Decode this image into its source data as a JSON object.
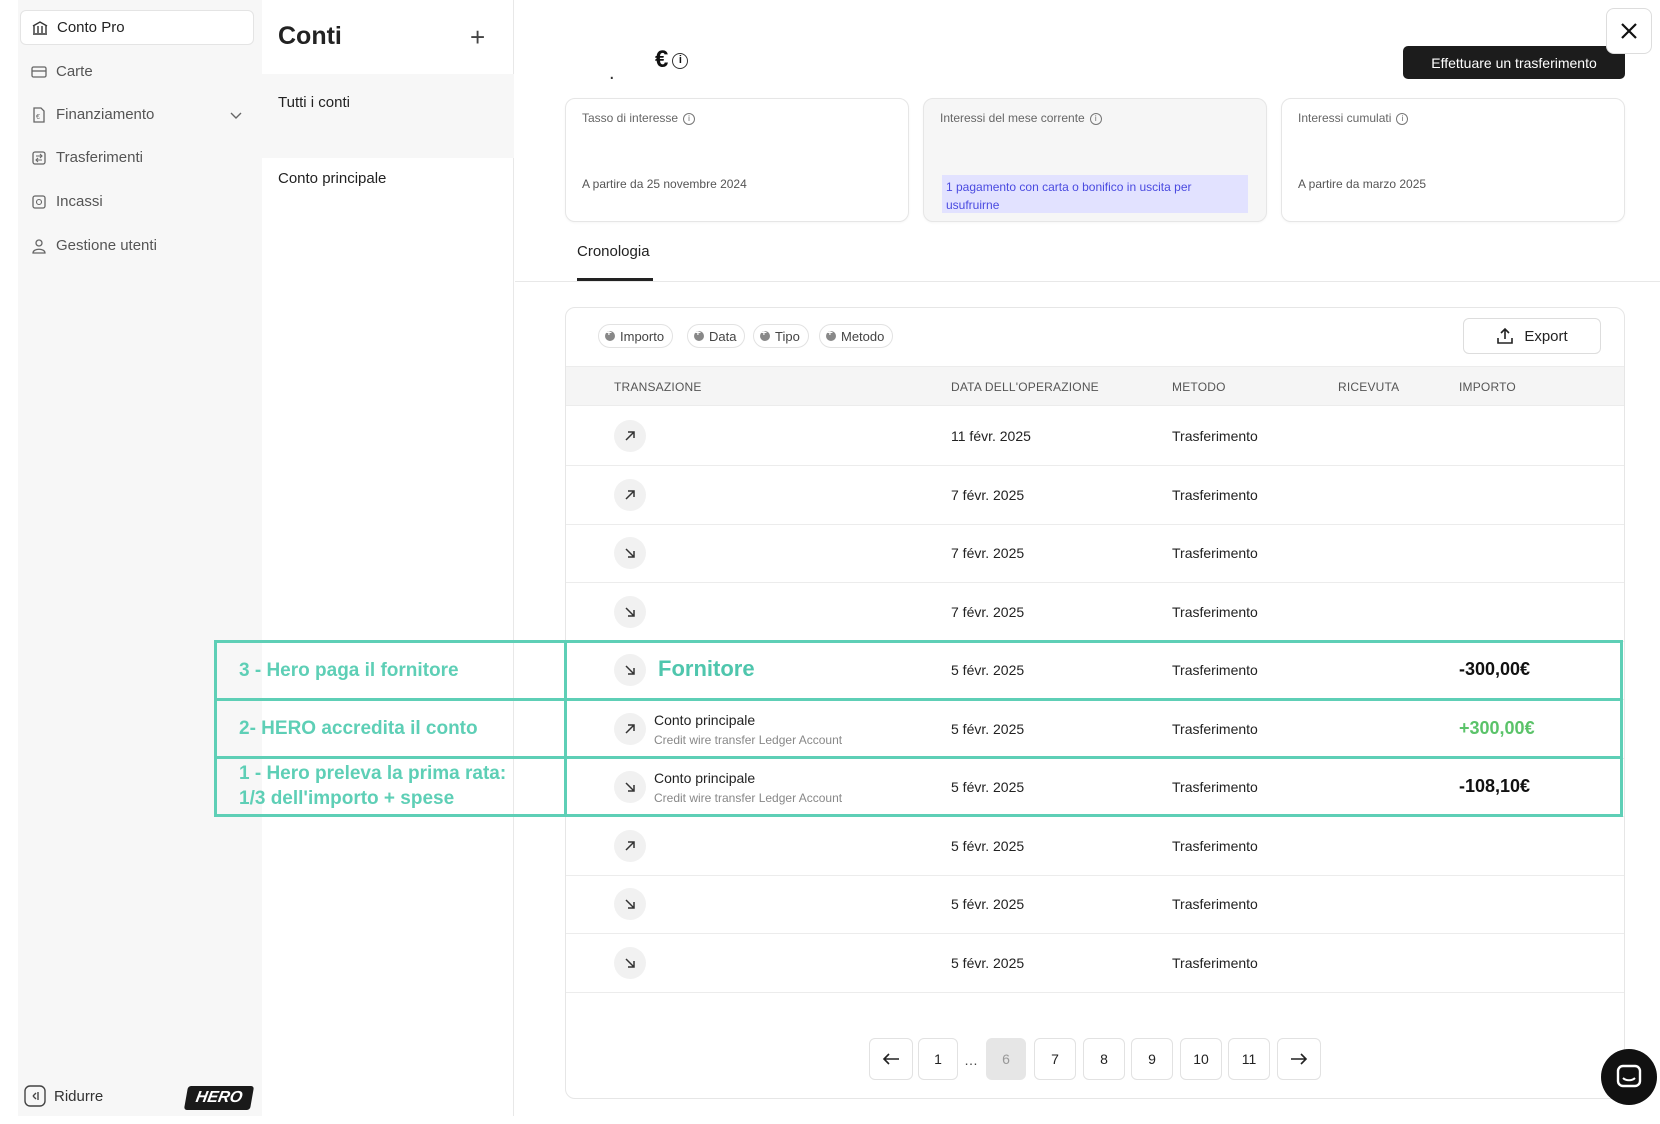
{
  "sidebar": {
    "items": [
      {
        "label": "Conto Pro",
        "icon": "bank-icon"
      },
      {
        "label": "Carte",
        "icon": "card-icon"
      },
      {
        "label": "Finanziamento",
        "icon": "document-euro-icon"
      },
      {
        "label": "Trasferimenti",
        "icon": "transfer-icon"
      },
      {
        "label": "Incassi",
        "icon": "collect-icon"
      },
      {
        "label": "Gestione utenti",
        "icon": "user-icon"
      }
    ],
    "collapse_label": "Ridurre",
    "logo_text": "HERO"
  },
  "accounts": {
    "title": "Conti",
    "add_label": "+",
    "all_label": "Tutti i conti",
    "main_label": "Conto principale"
  },
  "header": {
    "balance_value": ".",
    "currency": "€",
    "transfer_button": "Effettuare un trasferimento"
  },
  "cards": [
    {
      "label": "Tasso di interesse",
      "sub": "A partire da 25 novembre 2024"
    },
    {
      "label": "Interessi del mese corrente",
      "highlight": "1 pagamento con carta o bonifico in uscita per usufruirne"
    },
    {
      "label": "Interessi cumulati",
      "sub": "A partire da marzo 2025"
    }
  ],
  "tabs": {
    "history": "Cronologia"
  },
  "filters": [
    "Importo",
    "Data",
    "Tipo",
    "Metodo"
  ],
  "export_label": "Export",
  "table": {
    "headers": [
      "TRANSAZIONE",
      "DATA DELL'OPERAZIONE",
      "METODO",
      "RICEVUTA",
      "IMPORTO"
    ],
    "rows": [
      {
        "direction": "out",
        "name": "",
        "sub": "",
        "date": "11 févr. 2025",
        "method": "Trasferimento",
        "amount": ""
      },
      {
        "direction": "out",
        "name": "",
        "sub": "",
        "date": "7 févr. 2025",
        "method": "Trasferimento",
        "amount": ""
      },
      {
        "direction": "in",
        "name": "",
        "sub": "",
        "date": "7 févr. 2025",
        "method": "Trasferimento",
        "amount": ""
      },
      {
        "direction": "in",
        "name": "",
        "sub": "",
        "date": "7 févr. 2025",
        "method": "Trasferimento",
        "amount": ""
      },
      {
        "direction": "in",
        "name": "Fornitore",
        "sub": "",
        "date": "5 févr. 2025",
        "method": "Trasferimento",
        "amount": "-300,00€"
      },
      {
        "direction": "out",
        "name": "Conto principale",
        "sub": "Credit wire transfer Ledger Account",
        "date": "5 févr. 2025",
        "method": "Trasferimento",
        "amount": "+300,00€"
      },
      {
        "direction": "in",
        "name": "Conto principale",
        "sub": "Credit wire transfer Ledger Account",
        "date": "5 févr. 2025",
        "method": "Trasferimento",
        "amount": "-108,10€"
      },
      {
        "direction": "out",
        "name": "",
        "sub": "",
        "date": "5 févr. 2025",
        "method": "Trasferimento",
        "amount": ""
      },
      {
        "direction": "in",
        "name": "",
        "sub": "",
        "date": "5 févr. 2025",
        "method": "Trasferimento",
        "amount": ""
      },
      {
        "direction": "in",
        "name": "",
        "sub": "",
        "date": "5 févr. 2025",
        "method": "Trasferimento",
        "amount": ""
      }
    ]
  },
  "pagination": {
    "pages": [
      "1",
      "…",
      "6",
      "7",
      "8",
      "9",
      "10",
      "11"
    ],
    "current": "6"
  },
  "annotations": [
    {
      "text": "3 - Hero paga il fornitore"
    },
    {
      "text": "2- HERO accredita il conto"
    },
    {
      "text": "1 - Hero preleva la prima rata:\n1/3 dell'importo + spese"
    }
  ],
  "colors": {
    "annotation": "#5ecfb6",
    "positive_amount": "#5bc36a",
    "highlight_bg": "#e2e2ff",
    "highlight_text": "#4a4ae0"
  }
}
